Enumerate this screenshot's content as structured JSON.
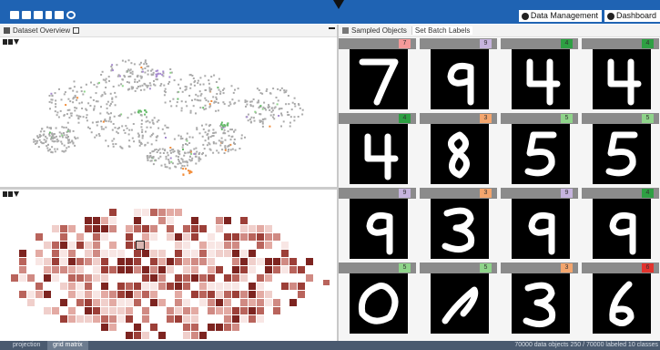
{
  "toolbar": {
    "icons": [
      "new-file-icon",
      "open-folder-icon",
      "save-icon",
      "delete-icon",
      "export-icon",
      "settings-icon"
    ],
    "buttons": [
      {
        "label": "Data Management",
        "icon": "database-icon"
      },
      {
        "label": "Dashboard",
        "icon": "dashboard-icon"
      }
    ]
  },
  "left_panel": {
    "title": "Dataset Overview",
    "tools": [
      "list-icon",
      "columns-icon",
      "filter-icon"
    ]
  },
  "right_panel": {
    "title": "Sampled Objects",
    "action": "Set Batch Labels"
  },
  "samples": [
    {
      "label": "7",
      "color": "#f49a9a",
      "digit": "7"
    },
    {
      "label": "9",
      "color": "#c6b4de",
      "digit": "9"
    },
    {
      "label": "4",
      "color": "#2ea043",
      "digit": "4"
    },
    {
      "label": "4",
      "color": "#2ea043",
      "digit": "4"
    },
    {
      "label": "4",
      "color": "#2ea043",
      "digit": "4"
    },
    {
      "label": "3",
      "color": "#f4a66e",
      "digit": "8"
    },
    {
      "label": "5",
      "color": "#8fd48a",
      "digit": "5"
    },
    {
      "label": "5",
      "color": "#8fd48a",
      "digit": "5"
    },
    {
      "label": "9",
      "color": "#c6b4de",
      "digit": "9"
    },
    {
      "label": "3",
      "color": "#f4a66e",
      "digit": "3"
    },
    {
      "label": "9",
      "color": "#c6b4de",
      "digit": "9"
    },
    {
      "label": "4",
      "color": "#2ea043",
      "digit": "9"
    },
    {
      "label": "5",
      "color": "#8fd48a",
      "digit": "0"
    },
    {
      "label": "5",
      "color": "#8fd48a",
      "digit": "1"
    },
    {
      "label": "3",
      "color": "#f4a66e",
      "digit": "3"
    },
    {
      "label": "6",
      "color": "#e2332d",
      "digit": "6"
    }
  ],
  "status": {
    "tabs": [
      "projection",
      "grid matrix"
    ],
    "active_tab": "grid matrix",
    "info": "70000 data objects   250 / 70000 labeled   10 classes"
  }
}
